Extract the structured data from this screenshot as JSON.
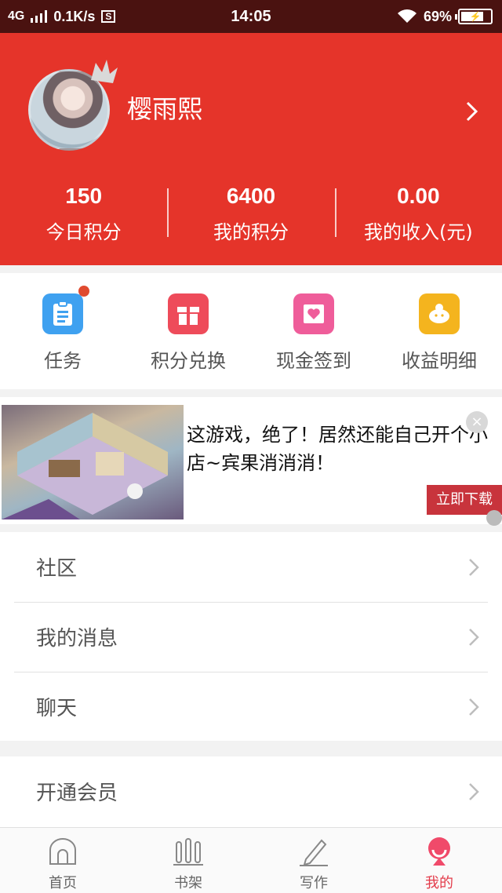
{
  "status_bar": {
    "network": "4G",
    "speed": "0.1K/s",
    "s_badge": "S",
    "time": "14:05",
    "battery": "69%",
    "battery_level": 0.69
  },
  "profile": {
    "username": "樱雨熙"
  },
  "stats": [
    {
      "value": "150",
      "label": "今日积分"
    },
    {
      "value": "6400",
      "label": "我的积分"
    },
    {
      "value": "0.00",
      "label": "我的收入(元)"
    }
  ],
  "quick_actions": [
    {
      "label": "任务",
      "icon": "task-clipboard-icon",
      "color": "#3fa1f0",
      "badge": true
    },
    {
      "label": "积分兑换",
      "icon": "gift-icon",
      "color": "#ee4b5a",
      "badge": false
    },
    {
      "label": "现金签到",
      "icon": "envelope-heart-icon",
      "color": "#ef5d9a",
      "badge": false
    },
    {
      "label": "收益明细",
      "icon": "piggy-bank-icon",
      "color": "#f4b41e",
      "badge": false
    }
  ],
  "ad": {
    "text": "这游戏，绝了！居然还能自己开个小店~宾果消消消！",
    "button": "立即下载",
    "close": "×"
  },
  "menu_group_1": [
    {
      "label": "社区"
    },
    {
      "label": "我的消息"
    },
    {
      "label": "聊天"
    }
  ],
  "menu_group_2": [
    {
      "label": "开通会员"
    }
  ],
  "bottom_nav": [
    {
      "label": "首页",
      "icon": "home-icon",
      "active": false
    },
    {
      "label": "书架",
      "icon": "bookshelf-icon",
      "active": false
    },
    {
      "label": "写作",
      "icon": "pencil-icon",
      "active": false
    },
    {
      "label": "我的",
      "icon": "profile-icon",
      "active": true
    }
  ],
  "colors": {
    "header_red": "#e5342a",
    "status_bar": "#4a1210",
    "active_nav": "#e33b4a"
  }
}
